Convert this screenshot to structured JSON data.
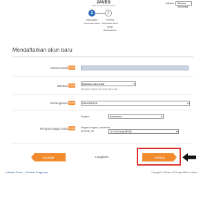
{
  "header": {
    "app_name": "JAVES",
    "app_subtitle": "Japan Visa Electronic System"
  },
  "language": {
    "label": "Bahasa",
    "selected": "Bahasa Indonesia"
  },
  "steps": [
    {
      "number": "1",
      "label": "Masukkan informasi akun",
      "active": true
    },
    {
      "number": "2",
      "label": "Periksa informasi akun yang dimasukkan",
      "active": false
    }
  ],
  "page_title": "Mendaftarkan akun baru",
  "required_badge": "Wajib",
  "form": {
    "email": {
      "label": "Alamat email",
      "value": ""
    },
    "language": {
      "label": "Bahasa",
      "value": "Bahasa Indonesia",
      "note": "Mengatur bahasa untuk layar dan email."
    },
    "nationality": {
      "label": "Kebangsaan",
      "value": "INDONESIA"
    },
    "residence": {
      "label": "Tempat tinggal Anda",
      "country_label": "Negara",
      "country_value": "Indonesia",
      "region_label": "Negara bagian, prefektur, provinsi, dll",
      "region_value": "DI YOGYAKARTA"
    }
  },
  "nav": {
    "back_label": "Kembali",
    "step_count": "Langkah1",
    "next_label": "Periksa"
  },
  "footer": {
    "links": [
      "Kebijakan Privasi",
      "Ketentuan Penggunaan"
    ],
    "copyright": "Copyright © Ministry of Foreign Affairs of Japan"
  },
  "colors": {
    "accent_orange": "#f28a2e",
    "step_blue": "#2e6fb5",
    "highlight_red": "#d9312a"
  }
}
